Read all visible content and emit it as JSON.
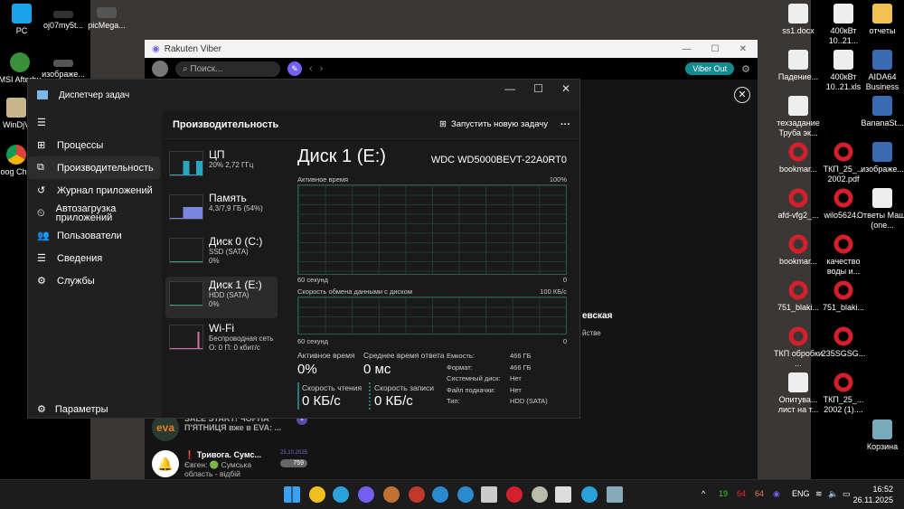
{
  "desktop": {
    "left_icons": [
      "PC",
      "oj07my5t...",
      "picMega...",
      "MSI Afterbu",
      "изображе...",
      "WinDjV",
      "Goog Chron"
    ],
    "right_icons": [
      {
        "label": "ss1.docx",
        "type": "doc"
      },
      {
        "label": "400кВт 10..21...",
        "type": "doc"
      },
      {
        "label": "отчеты",
        "type": "folder"
      },
      {
        "label": "Падение...",
        "type": "doc"
      },
      {
        "label": "400кВт 10..21.xls",
        "type": "doc"
      },
      {
        "label": "AIDA64 Business",
        "type": "app"
      },
      {
        "label": "техзадание Труба эк...",
        "type": "doc"
      },
      {
        "label": "BananaSt...",
        "type": "app"
      },
      {
        "label": "bookmar...",
        "type": "opera"
      },
      {
        "label": "ТКП_25_... 2002.pdf",
        "type": "opera"
      },
      {
        "label": "изображе...",
        "type": "app"
      },
      {
        "label": "afd-vfg2_...",
        "type": "opera"
      },
      {
        "label": "wilo5624...",
        "type": "opera"
      },
      {
        "label": "Ответы Маш.(one...",
        "type": "doc"
      },
      {
        "label": "bookmar...",
        "type": "opera"
      },
      {
        "label": "качество воды и...",
        "type": "opera"
      },
      {
        "label": "751_blaki...",
        "type": "opera"
      },
      {
        "label": "751_blaki...",
        "type": "opera"
      },
      {
        "label": "ТКП обробки ...",
        "type": "opera"
      },
      {
        "label": "235SGSG...",
        "type": "opera"
      },
      {
        "label": "Опитува... лист на т...",
        "type": "doc"
      },
      {
        "label": "ТКП_25_... 2002 (1)....",
        "type": "opera"
      },
      {
        "label": "Корзина",
        "type": "bin"
      }
    ]
  },
  "viber": {
    "title": "Rakuten Viber",
    "search_placeholder": "Поиск...",
    "viber_out": "Viber Out",
    "partial1": "евская",
    "partial2": "йстве",
    "chats": [
      {
        "name": "SALE START! ЧОРНА П'ЯТНИЦЯ вже в EVA: ...",
        "avatar": "eva",
        "badge": "1"
      },
      {
        "name": "❗ Тривога. Сумс...",
        "date": "23.10.2025",
        "preview": "Євген: 🟢 Сумська область - відбій повітря...",
        "badge": "759"
      }
    ]
  },
  "taskmgr": {
    "title": "Диспетчер задач",
    "nav": [
      {
        "label": "Процессы",
        "icon": "processes-icon"
      },
      {
        "label": "Производительность",
        "icon": "performance-icon",
        "selected": true
      },
      {
        "label": "Журнал приложений",
        "icon": "history-icon"
      },
      {
        "label": "Автозагрузка приложений",
        "icon": "startup-icon"
      },
      {
        "label": "Пользователи",
        "icon": "users-icon"
      },
      {
        "label": "Сведения",
        "icon": "details-icon"
      },
      {
        "label": "Службы",
        "icon": "services-icon"
      }
    ],
    "settings": "Параметры",
    "header": "Производительность",
    "run_task": "Запустить новую задачу",
    "devices": [
      {
        "name": "ЦП",
        "sub1": "20% 2,72 ГГц",
        "sub2": "",
        "color": "#2aa6c0"
      },
      {
        "name": "Память",
        "sub1": "4,3/7,9 ГБ (54%)",
        "sub2": "",
        "color": "#7b86e0"
      },
      {
        "name": "Диск 0 (C:)",
        "sub1": "SSD (SATA)",
        "sub2": "0%",
        "color": "#3d9a6e"
      },
      {
        "name": "Диск 1 (E:)",
        "sub1": "HDD (SATA)",
        "sub2": "0%",
        "color": "#3d9a6e",
        "selected": true
      },
      {
        "name": "Wi-Fi",
        "sub1": "Беспроводная сеть",
        "sub2": "О: 0 П: 0 кбит/с",
        "color": "#d36fa3"
      }
    ],
    "disk": {
      "title": "Диск 1 (E:)",
      "model": "WDC WD5000BEVT-22A0RT0",
      "active_label": "Активное время",
      "active_max": "100%",
      "time_left": "60 секунд",
      "zero": "0",
      "rate_label": "Скорость обмена данными с диском",
      "rate_max": "100 КБ/с",
      "active_time_label": "Активное время",
      "active_time": "0%",
      "resp_label": "Среднее время ответа",
      "resp": "0 мс",
      "read_label": "Скорость чтения",
      "read": "0 КБ/с",
      "write_label": "Скорость записи",
      "write": "0 КБ/с",
      "props": [
        [
          "Емкость:",
          "466 ГБ"
        ],
        [
          "Формат:",
          "466 ГБ"
        ],
        [
          "Системный диск:",
          "Нет"
        ],
        [
          "Файл подкачки:",
          "Нет"
        ],
        [
          "Тип:",
          "HDD (SATA)"
        ]
      ]
    }
  },
  "taskbar": {
    "lang": "ENG",
    "time": "16:52",
    "date": "26.11.2025",
    "tray": [
      "19",
      "64",
      "64"
    ]
  }
}
